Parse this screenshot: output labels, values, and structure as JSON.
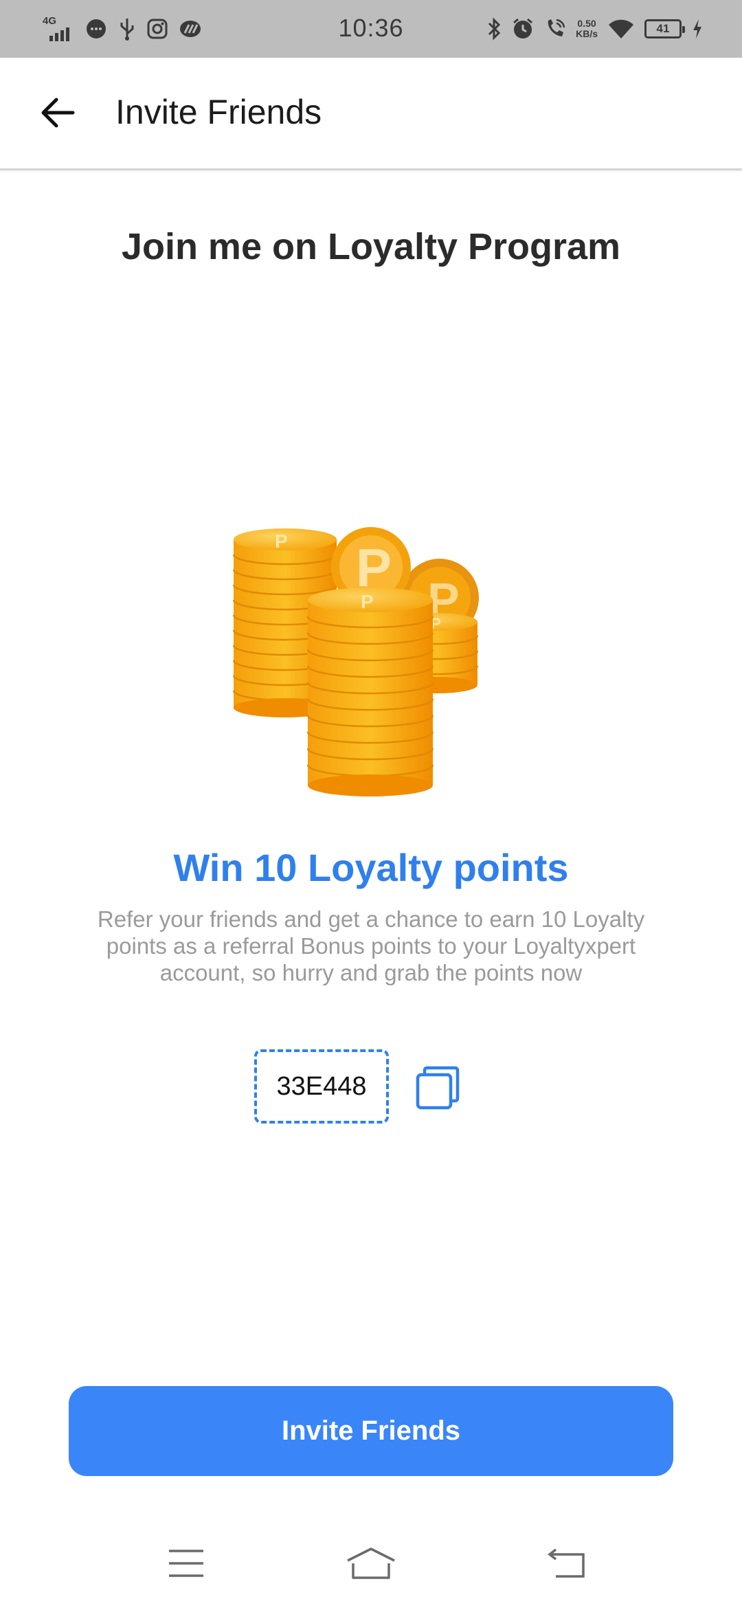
{
  "status_bar": {
    "network": "4G",
    "time": "10:36",
    "net_speed_value": "0.50",
    "net_speed_unit": "KB/s",
    "battery_level": "41"
  },
  "app_bar": {
    "title": "Invite Friends",
    "back_icon": "arrow-left-icon"
  },
  "content": {
    "headline": "Join me on Loyalty Program",
    "illustration": "gold-coins-stack",
    "reward_title": "Win 10 Loyalty points",
    "reward_description": "Refer your friends and get a chance to earn 10 Loyalty points as a referral Bonus points to your Loyaltyxpert account, so hurry and grab the points now",
    "referral_code": "33E448",
    "copy_icon": "copy-icon"
  },
  "actions": {
    "invite_button_label": "Invite Friends"
  },
  "nav_bar": {
    "items": [
      "menu-icon",
      "home-icon",
      "back-icon"
    ]
  },
  "colors": {
    "accent": "#3a86f8",
    "reward_text": "#2f80ed",
    "status_bar_bg": "#bdbdbd",
    "coin_gold": "#f7a21b"
  }
}
